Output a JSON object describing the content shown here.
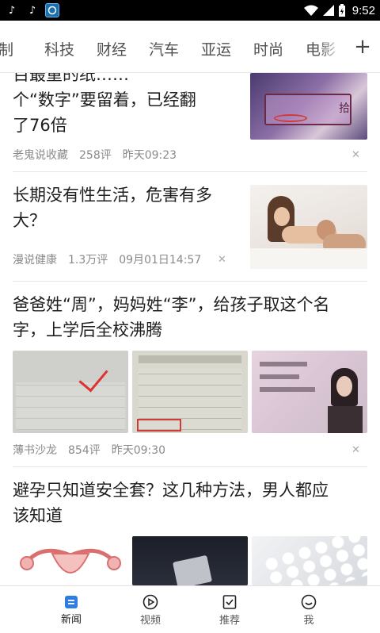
{
  "status_bar": {
    "apps": [
      "tiktok-icon",
      "tiktok-icon",
      "browser-app-icon"
    ],
    "time": "9:52"
  },
  "channels": {
    "items": [
      "制",
      "科技",
      "财经",
      "汽车",
      "亚运",
      "时尚",
      "电影"
    ],
    "add_label": "+"
  },
  "feed": {
    "articles": [
      {
        "title_lines": [
          "百最重的纸……",
          "个“数字”要留着，已经翻",
          "了76倍"
        ],
        "source": "老鬼说收藏",
        "comments": "258评",
        "time": "昨天09:23"
      },
      {
        "title_lines": [
          "长期没有性生活，危害有多",
          "大？"
        ],
        "source": "漫说健康",
        "comments": "1.3万评",
        "time": "09月01日14:57"
      },
      {
        "title_lines": [
          "爸爸姓“周”，妈妈姓“李”，给孩子取这个名",
          "字，上学后全校沸腾"
        ],
        "source": "薄书沙龙",
        "comments": "854评",
        "time": "昨天09:30"
      },
      {
        "title_lines": [
          "避孕只知道安全套？这几种方法，男人都应",
          "该知道"
        ]
      }
    ]
  },
  "bottom_nav": {
    "items": [
      {
        "label": "新闻",
        "icon": "news-icon",
        "active": true
      },
      {
        "label": "视频",
        "icon": "play-circle-icon",
        "active": false
      },
      {
        "label": "推荐",
        "icon": "checkbox-icon",
        "active": false
      },
      {
        "label": "我",
        "icon": "smiley-icon",
        "active": false
      }
    ]
  },
  "colors": {
    "accent": "#2f7de1",
    "text": "#1e1e1e",
    "meta": "#8a8a8a"
  }
}
